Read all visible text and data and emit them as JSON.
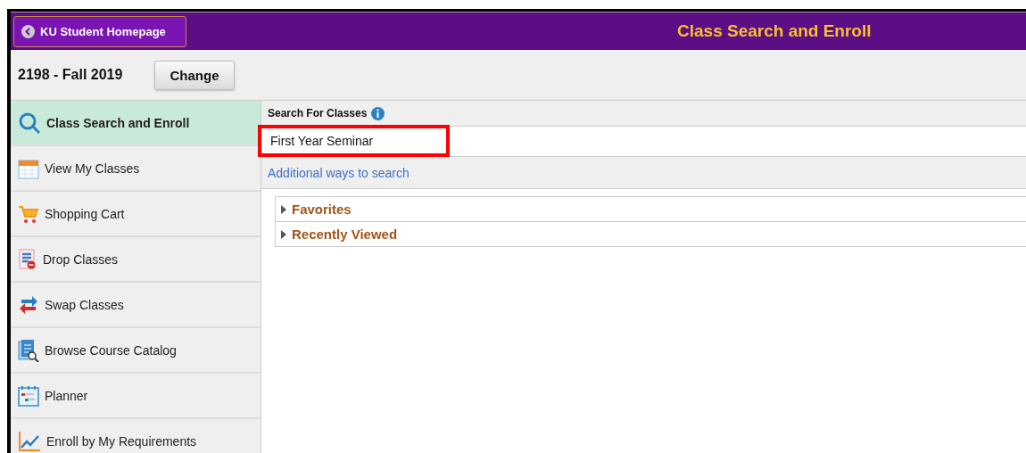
{
  "header": {
    "back_button": "KU Student Homepage",
    "title": "Class Search and Enroll"
  },
  "term": {
    "label": "2198 - Fall 2019",
    "button": "Change"
  },
  "sidebar": {
    "items": [
      {
        "kind": "search",
        "label": "Class Search and Enroll",
        "selected": true
      },
      {
        "kind": "calendar",
        "label": "View My Classes",
        "selected": false
      },
      {
        "kind": "cart",
        "label": "Shopping Cart",
        "selected": false
      },
      {
        "kind": "drop",
        "label": "Drop Classes",
        "selected": false
      },
      {
        "kind": "swap",
        "label": "Swap Classes",
        "selected": false
      },
      {
        "kind": "catalog",
        "label": "Browse Course Catalog",
        "selected": false
      },
      {
        "kind": "planner",
        "label": "Planner",
        "selected": false
      },
      {
        "kind": "chart",
        "label": "Enroll by My Requirements",
        "selected": false
      }
    ]
  },
  "search": {
    "heading": "Search For Classes",
    "value": "First Year Seminar",
    "highlighted": true,
    "link": "Additional ways to search"
  },
  "sections": [
    {
      "label": "Favorites",
      "expanded": false
    },
    {
      "label": "Recently Viewed",
      "expanded": false
    }
  ]
}
